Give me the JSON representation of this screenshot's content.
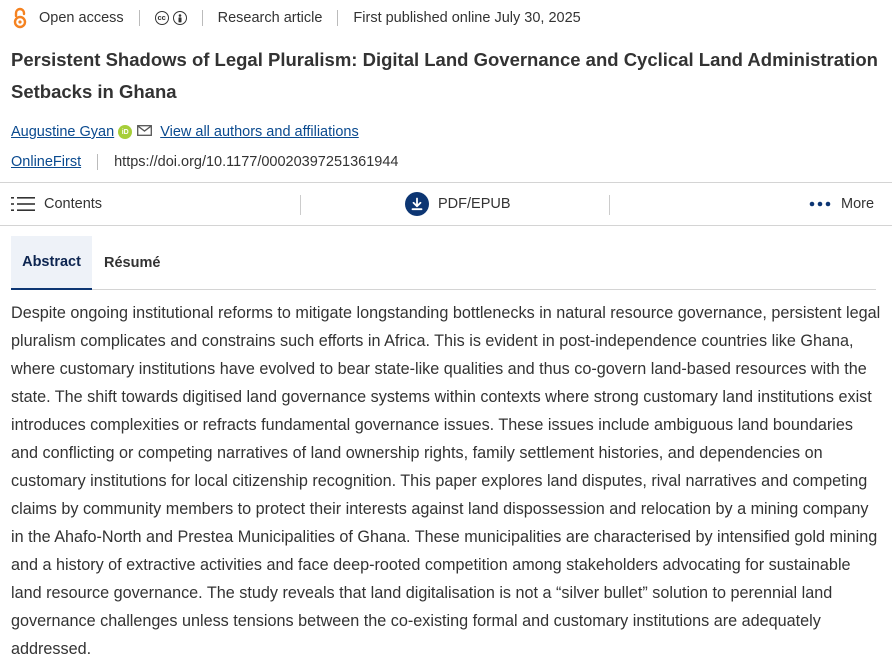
{
  "meta": {
    "open_access": "Open access",
    "article_type": "Research article",
    "published": "First published online July 30, 2025"
  },
  "article": {
    "title": "Persistent Shadows of Legal Pluralism: Digital Land Governance and Cyclical Land Administration Setbacks in Ghana",
    "author": "Augustine Gyan",
    "view_authors": "View all authors and affiliations",
    "status": "OnlineFirst",
    "doi": "https://doi.org/10.1177/00020397251361944"
  },
  "toolbar": {
    "contents": "Contents",
    "pdf": "PDF/EPUB",
    "more": "More"
  },
  "tabs": [
    {
      "label": "Abstract"
    },
    {
      "label": "Résumé"
    }
  ],
  "abstract_text": "Despite ongoing institutional reforms to mitigate longstanding bottlenecks in natural resource governance, persistent legal pluralism complicates and constrains such efforts in Africa. This is evident in post-independence countries like Ghana, where customary institutions have evolved to bear state-like qualities and thus co-govern land-based resources with the state. The shift towards digitised land governance systems within contexts where strong customary land institutions exist introduces complexities or refracts fundamental governance issues. These issues include ambiguous land boundaries and conflicting or competing narratives of land ownership rights, family settlement histories, and dependencies on customary institutions for local citizenship recognition. This paper explores land disputes, rival narratives and competing claims by community members to protect their interests against land dispossession and relocation by a mining company in the Ahafo-North and Prestea Municipalities of Ghana. These municipalities are characterised by intensified gold mining and a history of extractive activities and face deep-rooted competition among stakeholders advocating for sustainable land resource governance. The study reveals that land digitalisation is not a “silver bullet” solution to perennial land governance challenges unless tensions between the co-existing formal and customary institutions are adequately addressed.",
  "colors": {
    "open_access_orange": "#f58220",
    "link_blue": "#0a4a8f",
    "brand_navy": "#0d3673",
    "orcid_green": "#a6ce39"
  }
}
